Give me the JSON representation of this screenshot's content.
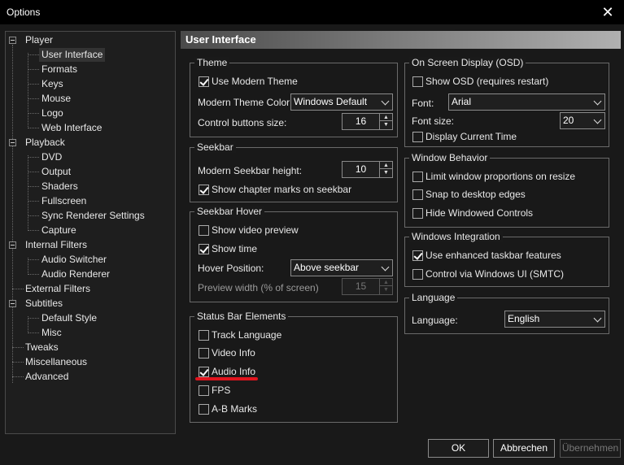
{
  "window": {
    "title": "Options",
    "close_glyph": "✕"
  },
  "tree": {
    "items": [
      {
        "label": "Player"
      },
      {
        "label": "User Interface"
      },
      {
        "label": "Formats"
      },
      {
        "label": "Keys"
      },
      {
        "label": "Mouse"
      },
      {
        "label": "Logo"
      },
      {
        "label": "Web Interface"
      },
      {
        "label": "Playback"
      },
      {
        "label": "DVD"
      },
      {
        "label": "Output"
      },
      {
        "label": "Shaders"
      },
      {
        "label": "Fullscreen"
      },
      {
        "label": "Sync Renderer Settings"
      },
      {
        "label": "Capture"
      },
      {
        "label": "Internal Filters"
      },
      {
        "label": "Audio Switcher"
      },
      {
        "label": "Audio Renderer"
      },
      {
        "label": "External Filters"
      },
      {
        "label": "Subtitles"
      },
      {
        "label": "Default Style"
      },
      {
        "label": "Misc"
      },
      {
        "label": "Tweaks"
      },
      {
        "label": "Miscellaneous"
      },
      {
        "label": "Advanced"
      }
    ],
    "selected": "User Interface"
  },
  "page": {
    "title": "User Interface"
  },
  "theme": {
    "title": "Theme",
    "use_modern_theme": {
      "label": "Use Modern Theme",
      "checked": true
    },
    "color_label": "Modern Theme Color:",
    "color_value": "Windows Default",
    "buttons_size_label": "Control buttons size:",
    "buttons_size_value": "16"
  },
  "seekbar": {
    "title": "Seekbar",
    "height_label": "Modern Seekbar height:",
    "height_value": "10",
    "chapter_marks": {
      "label": "Show chapter marks on seekbar",
      "checked": true
    }
  },
  "seekbar_hover": {
    "title": "Seekbar Hover",
    "video_preview": {
      "label": "Show video preview",
      "checked": false
    },
    "show_time": {
      "label": "Show time",
      "checked": true
    },
    "position_label": "Hover Position:",
    "position_value": "Above seekbar",
    "preview_width_label": "Preview width (% of screen)",
    "preview_width_value": "15"
  },
  "status_bar": {
    "title": "Status Bar Elements",
    "items": [
      {
        "label": "Track Language",
        "checked": false
      },
      {
        "label": "Video Info",
        "checked": false
      },
      {
        "label": "Audio Info",
        "checked": true
      },
      {
        "label": "FPS",
        "checked": false
      },
      {
        "label": "A-B Marks",
        "checked": false
      }
    ]
  },
  "osd": {
    "title": "On Screen Display (OSD)",
    "show_osd": {
      "label": "Show OSD (requires restart)",
      "checked": false
    },
    "font_label": "Font:",
    "font_value": "Arial",
    "font_size_label": "Font size:",
    "font_size_value": "20",
    "display_time": {
      "label": "Display Current Time",
      "checked": false
    }
  },
  "window_behavior": {
    "title": "Window Behavior",
    "items": [
      {
        "label": "Limit window proportions on resize",
        "checked": false
      },
      {
        "label": "Snap to desktop edges",
        "checked": false
      },
      {
        "label": "Hide Windowed Controls",
        "checked": false
      }
    ]
  },
  "windows_integration": {
    "title": "Windows Integration",
    "items": [
      {
        "label": "Use enhanced taskbar features",
        "checked": true
      },
      {
        "label": "Control via Windows UI (SMTC)",
        "checked": false
      }
    ]
  },
  "language": {
    "title": "Language",
    "label": "Language:",
    "value": "English"
  },
  "buttons": {
    "ok": "OK",
    "cancel": "Abbrechen",
    "apply": "Übernehmen"
  },
  "colors": {
    "background": "#191919",
    "titlebar": "#000000",
    "annotation": "#e0141e"
  }
}
